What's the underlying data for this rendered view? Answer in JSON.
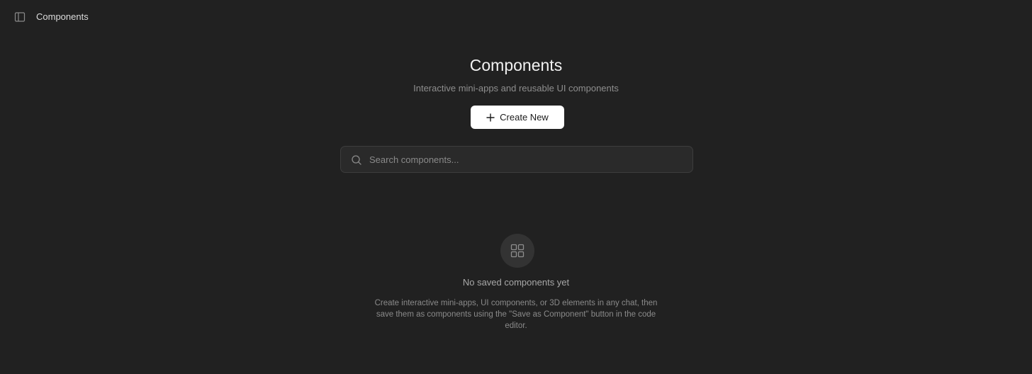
{
  "topbar": {
    "title": "Components",
    "toggle_icon": "sidebar-toggle-icon"
  },
  "header": {
    "title": "Components",
    "subtitle": "Interactive mini-apps and reusable UI components"
  },
  "actions": {
    "create_label": "Create New",
    "create_icon": "plus-icon"
  },
  "search": {
    "placeholder": "Search components...",
    "value": "",
    "icon": "search-icon"
  },
  "empty_state": {
    "icon": "grid-icon",
    "title": "No saved components yet",
    "description": "Create interactive mini-apps, UI components, or 3D elements in any chat, then save them as components using the \"Save as Component\" button in the code editor."
  },
  "colors": {
    "background": "#212121",
    "button_bg": "#ffffff",
    "input_bg": "#2a2a2a",
    "input_border": "#3d3d3d",
    "icon_circle": "#333333"
  }
}
